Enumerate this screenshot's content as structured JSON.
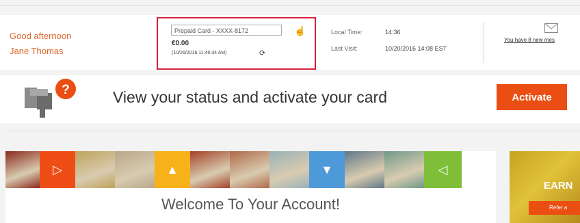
{
  "header": {
    "greeting": "Good afternoon",
    "user_name": "Jane Thomas",
    "card": {
      "selector_label": "Prepaid Card - XXXX-8172",
      "balance": "€0.00",
      "balance_timestamp": "(10/26/2016 11:46:34 AM)"
    },
    "local_time_label": "Local Time:",
    "local_time_value": "14:36",
    "last_visit_label": "Last Visit:",
    "last_visit_value": "10/20/2016 14:08 EST",
    "messages_link": "You have 8 new mes"
  },
  "banner": {
    "text": "View your status and activate your card",
    "activate_label": "Activate",
    "help_glyph": "?"
  },
  "welcome": {
    "title": "Welcome To Your Account!",
    "strip_tiles": [
      {
        "kind": "photo",
        "color": "#8a2a1c"
      },
      {
        "kind": "arrow",
        "color": "#ef4d16",
        "glyph": "▷"
      },
      {
        "kind": "photo",
        "color": "#bfa35a"
      },
      {
        "kind": "photo",
        "color": "#b8a888"
      },
      {
        "kind": "arrow",
        "color": "#f7b21a",
        "glyph": "▲"
      },
      {
        "kind": "photo",
        "color": "#a4432a"
      },
      {
        "kind": "photo",
        "color": "#b06a4a"
      },
      {
        "kind": "photo",
        "color": "#9ab2b8"
      },
      {
        "kind": "arrow",
        "color": "#4e9ad8",
        "glyph": "▼"
      },
      {
        "kind": "photo",
        "color": "#607888"
      },
      {
        "kind": "photo",
        "color": "#6f9a8a"
      },
      {
        "kind": "arrow",
        "color": "#7fbe38",
        "glyph": "◁"
      }
    ]
  },
  "promo": {
    "text": "EARN",
    "button_label": "Refer a"
  }
}
